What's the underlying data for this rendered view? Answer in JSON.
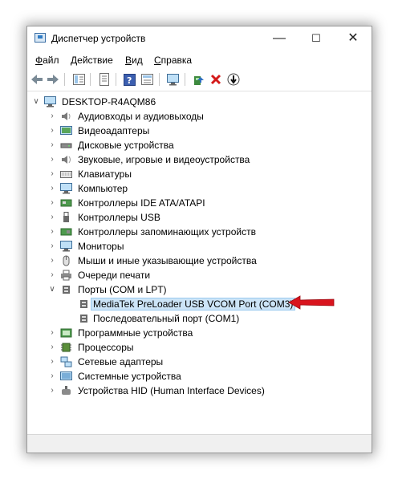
{
  "window": {
    "title": "Диспетчер устройств",
    "controls": {
      "minimize": "—",
      "maximize": "☐",
      "close": "✕"
    }
  },
  "menu": [
    {
      "accel": "Ф",
      "rest": "айл"
    },
    {
      "accel": "Д",
      "rest": "ействие"
    },
    {
      "accel": "В",
      "rest": "ид"
    },
    {
      "accel": "С",
      "rest": "правка"
    }
  ],
  "tree": {
    "root": "DESKTOP-R4AQM86",
    "categories": [
      "Аудиовходы и аудиовыходы",
      "Видеоадаптеры",
      "Дисковые устройства",
      "Звуковые, игровые и видеоустройства",
      "Клавиатуры",
      "Компьютер",
      "Контроллеры IDE ATA/ATAPI",
      "Контроллеры USB",
      "Контроллеры запоминающих устройств",
      "Мониторы",
      "Мыши и иные указывающие устройства",
      "Очереди печати",
      "Порты (COM и LPT)",
      "Программные устройства",
      "Процессоры",
      "Сетевые адаптеры",
      "Системные устройства",
      "Устройства HID (Human Interface Devices)"
    ],
    "ports_children": [
      "MediaTek PreLoader USB VCOM Port (COM3)",
      "Последовательный порт (COM1)"
    ]
  },
  "colors": {
    "highlight_arrow": "#d9141e",
    "selection": "#cce4f7"
  }
}
